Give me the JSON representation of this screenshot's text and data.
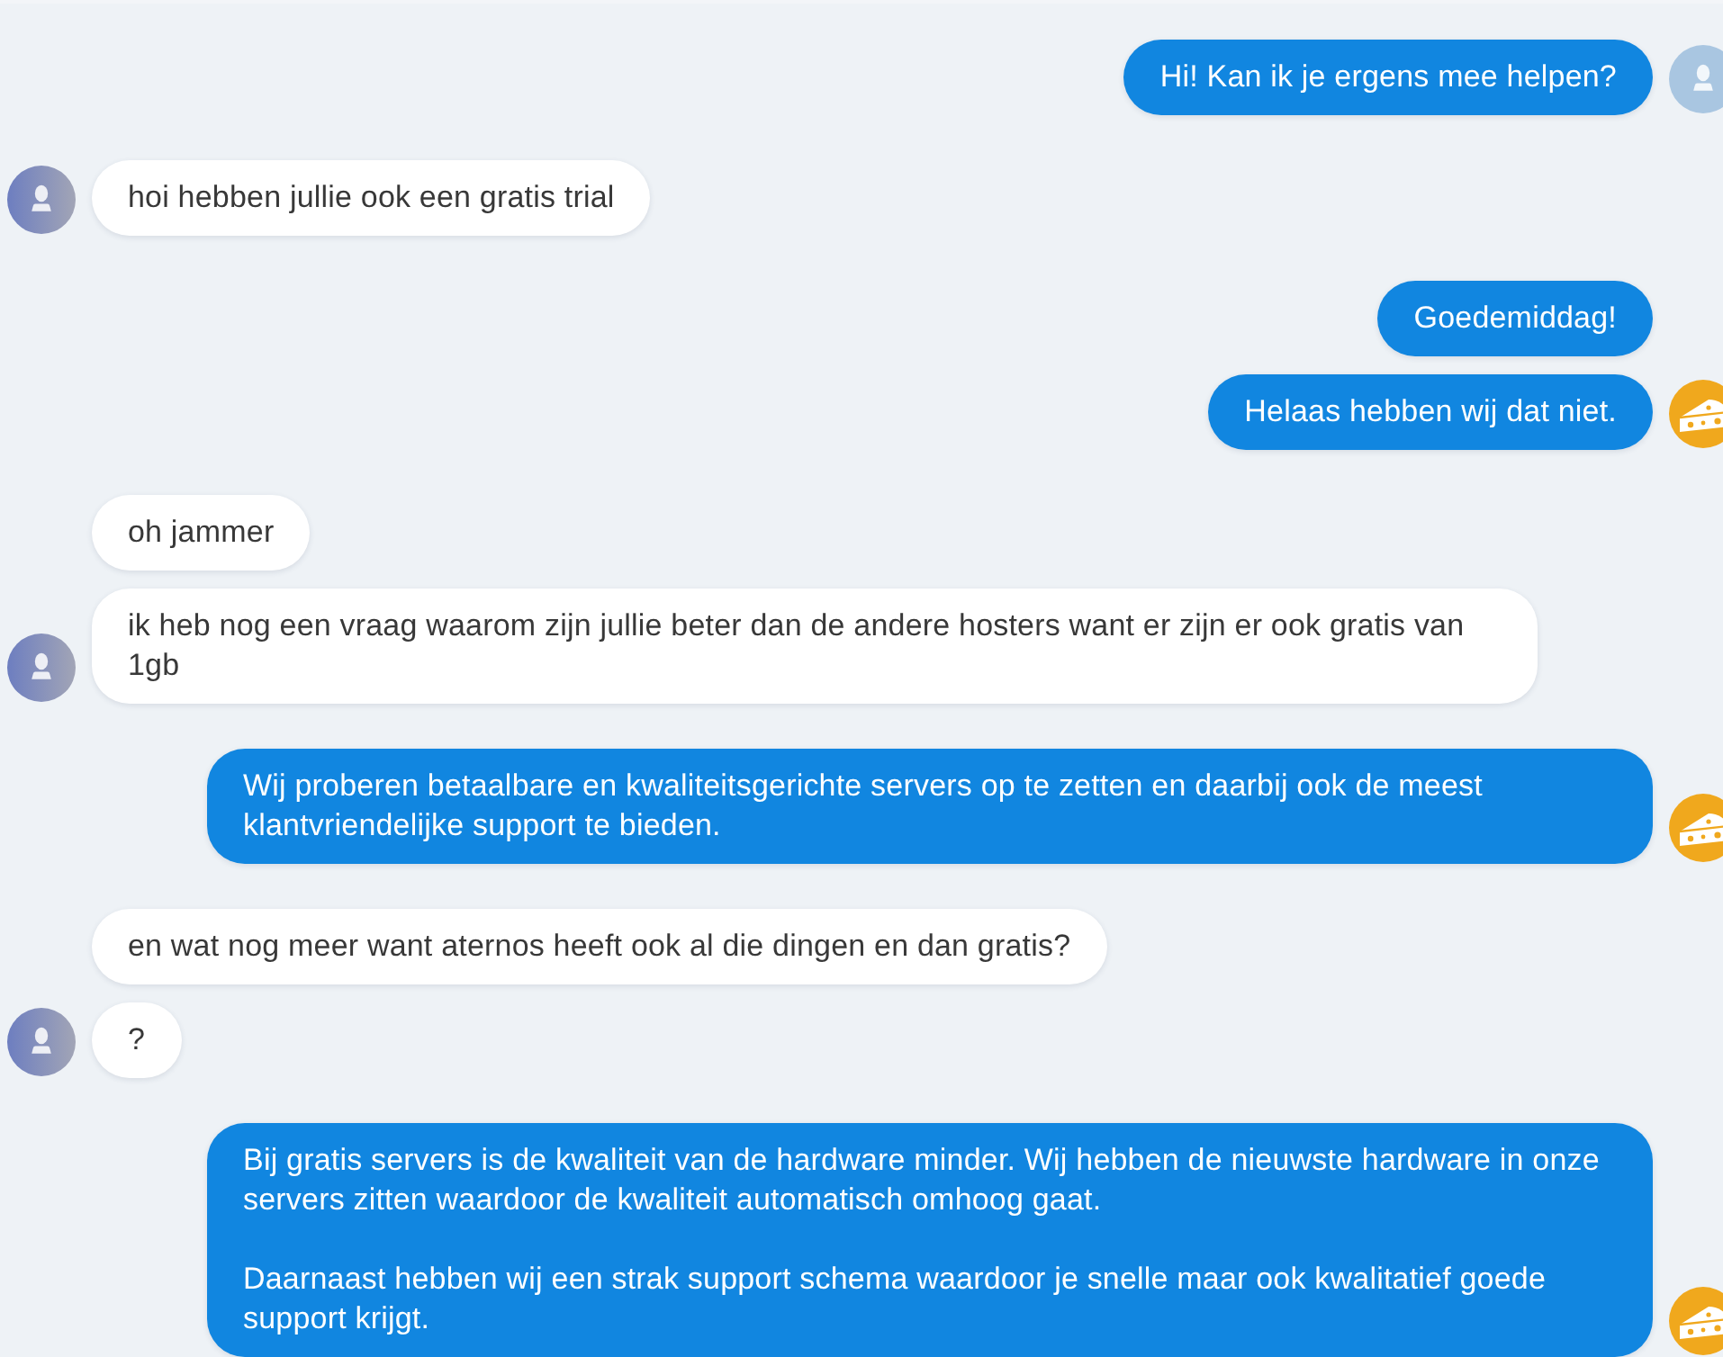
{
  "chat": {
    "message_groups": [
      {
        "kind": "agent",
        "avatar": {
          "kind": "agent_default"
        },
        "bubbles": [
          "Hi! Kan ik je ergens mee helpen?"
        ]
      },
      {
        "kind": "visitor",
        "avatar": {
          "kind": "visitor"
        },
        "bubbles": [
          "hoi hebben jullie ook een gratis trial"
        ]
      },
      {
        "kind": "agent",
        "avatar": {
          "kind": "cheese"
        },
        "bubbles": [
          "Goedemiddag!",
          "Helaas hebben wij dat niet."
        ]
      },
      {
        "kind": "visitor",
        "avatar": {
          "kind": "visitor"
        },
        "bubbles": [
          "oh jammer",
          "ik heb nog een vraag waarom zijn jullie beter dan de andere hosters want er zijn er ook gratis van 1gb"
        ]
      },
      {
        "kind": "agent",
        "avatar": {
          "kind": "cheese"
        },
        "bubbles": [
          "Wij proberen betaalbare en kwaliteitsgerichte servers op te zetten en daarbij ook de meest klantvriendelijke support te bieden."
        ]
      },
      {
        "kind": "visitor",
        "avatar": {
          "kind": "visitor"
        },
        "bubbles": [
          "en wat nog meer want aternos heeft ook al die dingen en dan gratis?",
          "?"
        ]
      },
      {
        "kind": "agent",
        "avatar": {
          "kind": "cheese"
        },
        "bubbles": [
          "Bij gratis servers is de kwaliteit van de hardware minder. Wij hebben de nieuwste hardware in onze servers zitten waardoor de kwaliteit automatisch omhoog gaat.\n\nDaarnaast hebben wij een strak support schema waardoor je snelle maar ook kwalitatief goede support krijgt."
        ]
      }
    ]
  }
}
